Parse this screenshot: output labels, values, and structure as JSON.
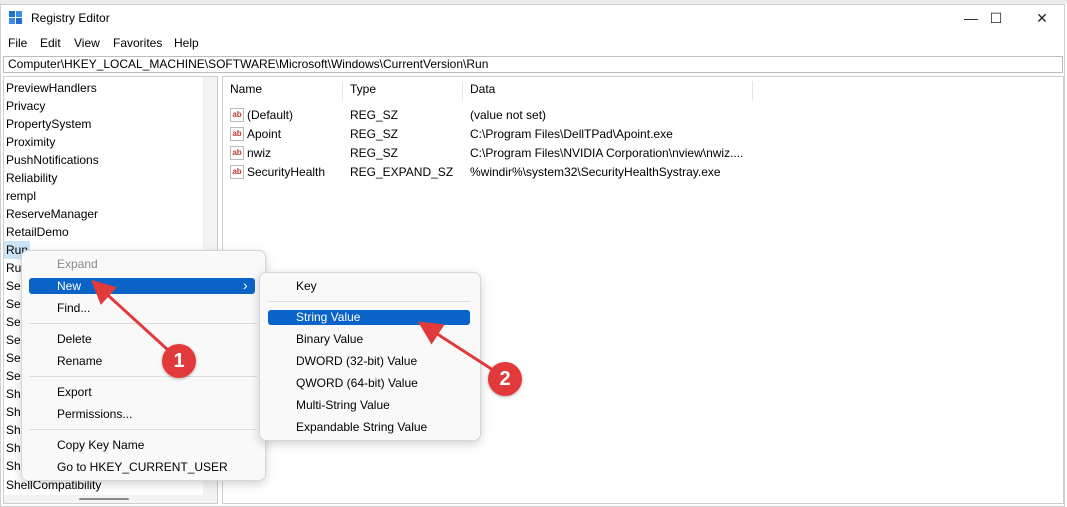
{
  "window": {
    "title": "Registry Editor",
    "minimize": "—",
    "maximize": "☐",
    "close": "✕"
  },
  "menu": [
    "File",
    "Edit",
    "View",
    "Favorites",
    "Help"
  ],
  "address": "Computer\\HKEY_LOCAL_MACHINE\\SOFTWARE\\Microsoft\\Windows\\CurrentVersion\\Run",
  "tree": [
    "PreviewHandlers",
    "Privacy",
    "PropertySystem",
    "Proximity",
    "PushNotifications",
    "Reliability",
    "rempl",
    "ReserveManager",
    "RetailDemo",
    "Run"
  ],
  "tree_partial": [
    "Ru",
    "Se",
    "Se",
    "Se",
    "Se",
    "Se",
    "Se",
    "Sh",
    "Sh",
    "Sh",
    "Sh",
    "Sh"
  ],
  "tree_bottom": "ShellCompatibility",
  "columns": {
    "name": "Name",
    "type": "Type",
    "data": "Data"
  },
  "values": [
    {
      "name": "(Default)",
      "type": "REG_SZ",
      "data": "(value not set)"
    },
    {
      "name": "Apoint",
      "type": "REG_SZ",
      "data": "C:\\Program Files\\DellTPad\\Apoint.exe"
    },
    {
      "name": "nwiz",
      "type": "REG_SZ",
      "data": "C:\\Program Files\\NVIDIA Corporation\\nview\\nwiz...."
    },
    {
      "name": "SecurityHealth",
      "type": "REG_EXPAND_SZ",
      "data": "%windir%\\system32\\SecurityHealthSystray.exe"
    }
  ],
  "context_menu": {
    "items": [
      "Expand",
      "New",
      "Find...",
      "Delete",
      "Rename",
      "Export",
      "Permissions...",
      "Copy Key Name",
      "Go to HKEY_CURRENT_USER"
    ],
    "submenu_chevron": "›"
  },
  "submenu": [
    "Key",
    "String Value",
    "Binary Value",
    "DWORD (32-bit) Value",
    "QWORD (64-bit) Value",
    "Multi-String Value",
    "Expandable String Value"
  ],
  "callouts": [
    "1",
    "2"
  ],
  "colors": {
    "highlight": "#0a64c8",
    "callout": "#e23a3a",
    "selection": "#cce4f7"
  }
}
